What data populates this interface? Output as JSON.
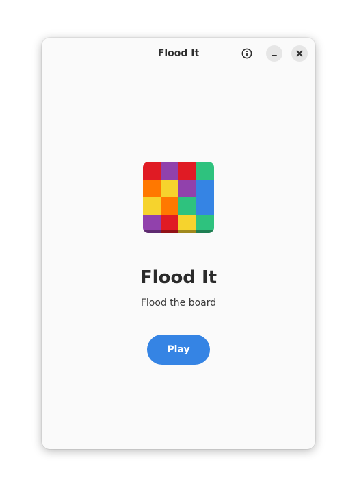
{
  "window": {
    "title": "Flood It"
  },
  "headerbar": {
    "buttons": [
      {
        "icon": "info-icon"
      },
      {
        "icon": "minimize-icon"
      },
      {
        "icon": "close-icon"
      }
    ]
  },
  "main": {
    "app_icon": {
      "icon": "flood-it-board-icon",
      "grid": [
        [
          "#e01b24",
          "#9141ac",
          "#e01b24",
          "#2ec27e"
        ],
        [
          "#ff7800",
          "#f6d32d",
          "#9141ac",
          "#3584e4"
        ],
        [
          "#f6d32d",
          "#ff7800",
          "#2ec27e",
          "#3584e4"
        ],
        [
          "#9141ac",
          "#e01b24",
          "#f6d32d",
          "#2ec27e"
        ]
      ]
    },
    "title": "Flood It",
    "subtitle": "Flood the board",
    "play_label": "Play"
  },
  "colors": {
    "accent": "#3584e4",
    "window_bg": "#fafafa"
  }
}
